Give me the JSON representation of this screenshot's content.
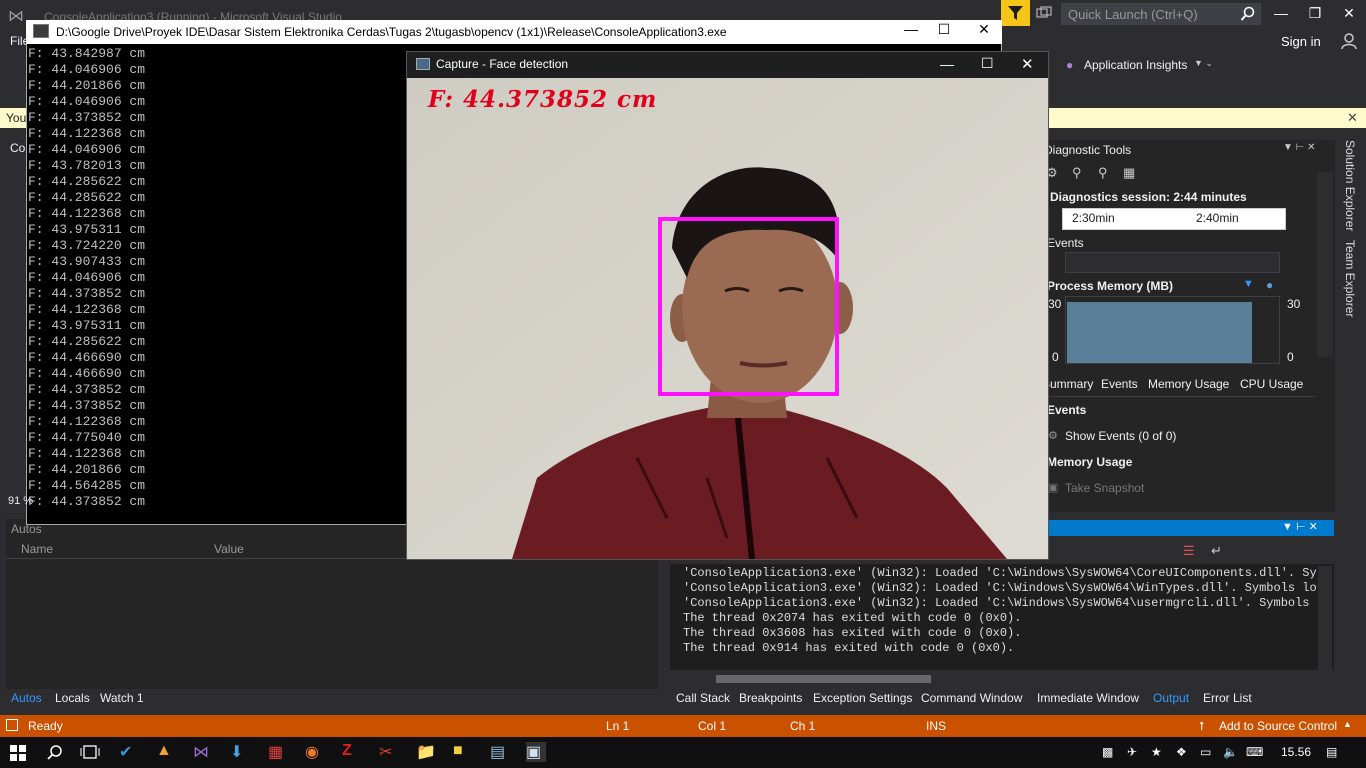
{
  "vs": {
    "title": "ConsoleApplication3 (Running) - Microsoft Visual Studio",
    "quick_launch_placeholder": "Quick Launch (Ctrl+Q)",
    "sign_in": "Sign in",
    "menu_file": "File",
    "app_insights": "Application Insights",
    "infobar_text": "You",
    "left_label_co": "Co",
    "left_label_91": "91 %"
  },
  "console": {
    "title": "D:\\Google Drive\\Proyek IDE\\Dasar Sistem Elektronika Cerdas\\Tugas 2\\tugasb\\opencv (1x1)\\Release\\ConsoleApplication3.exe",
    "lines": [
      "F: 43.842987 cm",
      "F: 44.046906 cm",
      "F: 44.201866 cm",
      "F: 44.046906 cm",
      "F: 44.373852 cm",
      "F: 44.122368 cm",
      "F: 44.046906 cm",
      "F: 43.782013 cm",
      "F: 44.285622 cm",
      "F: 44.285622 cm",
      "F: 44.122368 cm",
      "F: 43.975311 cm",
      "F: 43.724220 cm",
      "F: 43.907433 cm",
      "F: 44.046906 cm",
      "F: 44.373852 cm",
      "F: 44.122368 cm",
      "F: 43.975311 cm",
      "F: 44.285622 cm",
      "F: 44.466690 cm",
      "F: 44.466690 cm",
      "F: 44.373852 cm",
      "F: 44.373852 cm",
      "F: 44.122368 cm",
      "F: 44.775040 cm",
      "F: 44.122368 cm",
      "F: 44.201866 cm",
      "F: 44.564285 cm",
      "F: 44.373852 cm"
    ]
  },
  "capture": {
    "title": "Capture - Face detection",
    "distance_overlay": "F: 44.373852 cm",
    "face_box_color": "#ff10ff"
  },
  "diagnostics": {
    "title": "Diagnostic Tools",
    "session": "Diagnostics session: 2:44 minutes",
    "timeline_ticks": [
      "2:30min",
      "2:40min"
    ],
    "events_label": "Events",
    "process_memory_label": "Process Memory (MB)",
    "memory_max": "30",
    "memory_min": "0",
    "tabs": [
      "Summary",
      "Events",
      "Memory Usage",
      "CPU Usage"
    ],
    "events_section": "Events",
    "show_events": "Show Events (0 of 0)",
    "memory_usage_section": "Memory Usage",
    "take_snapshot": "Take Snapshot",
    "side_tabs": [
      "Solution Explorer",
      "Team Explorer"
    ]
  },
  "output": {
    "lines": [
      "'ConsoleApplication3.exe' (Win32): Loaded 'C:\\Windows\\SysWOW64\\CoreUIComponents.dll'. Symbols loaded.",
      "'ConsoleApplication3.exe' (Win32): Loaded 'C:\\Windows\\SysWOW64\\WinTypes.dll'. Symbols loaded.",
      "'ConsoleApplication3.exe' (Win32): Loaded 'C:\\Windows\\SysWOW64\\usermgrcli.dll'. Symbols loaded.",
      "The thread 0x2074 has exited with code 0 (0x0).",
      "The thread 0x3608 has exited with code 0 (0x0).",
      "The thread 0x914 has exited with code 0 (0x0)."
    ]
  },
  "autos": {
    "title": "Autos",
    "col_name": "Name",
    "col_value": "Value"
  },
  "bottom_left_tabs": [
    "Autos",
    "Locals",
    "Watch 1"
  ],
  "bottom_right_tabs": [
    "Call Stack",
    "Breakpoints",
    "Exception Settings",
    "Command Window",
    "Immediate Window",
    "Output",
    "Error List"
  ],
  "status": {
    "ready": "Ready",
    "ln": "Ln 1",
    "col": "Col 1",
    "ch": "Ch 1",
    "ins": "INS",
    "add_source": "Add to Source Control"
  },
  "taskbar": {
    "time": "15.56"
  },
  "colors": {
    "accent": "#007acc",
    "status_bar": "#ca5100",
    "overlay_text": "#e0001a"
  }
}
